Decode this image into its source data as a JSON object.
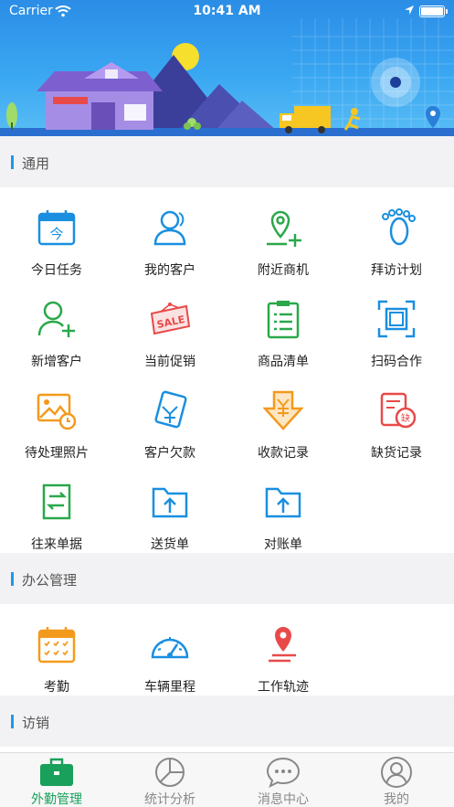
{
  "status_bar": {
    "carrier": "Carrier",
    "time": "10:41 AM"
  },
  "sections": [
    {
      "title": "通用",
      "items": [
        {
          "label": "今日任务",
          "icon": "calendar-today-icon",
          "color": "#1a8fe0"
        },
        {
          "label": "我的客户",
          "icon": "customers-icon",
          "color": "#1a8fe0"
        },
        {
          "label": "附近商机",
          "icon": "nearby-location-icon",
          "color": "#2aa84a"
        },
        {
          "label": "拜访计划",
          "icon": "footprint-icon",
          "color": "#1a8fe0"
        },
        {
          "label": "新增客户",
          "icon": "add-user-icon",
          "color": "#2aa84a"
        },
        {
          "label": "当前促销",
          "icon": "sale-tag-icon",
          "color": "#e84a4a"
        },
        {
          "label": "商品清单",
          "icon": "clipboard-list-icon",
          "color": "#2aa84a"
        },
        {
          "label": "扫码合作",
          "icon": "scan-icon",
          "color": "#1a8fe0"
        },
        {
          "label": "待处理照片",
          "icon": "photo-clock-icon",
          "color": "#f39a1d"
        },
        {
          "label": "客户欠款",
          "icon": "debt-icon",
          "color": "#1a8fe0"
        },
        {
          "label": "收款记录",
          "icon": "yen-download-icon",
          "color": "#f39a1d"
        },
        {
          "label": "缺货记录",
          "icon": "shortage-icon",
          "color": "#e84a4a"
        },
        {
          "label": "往来单据",
          "icon": "transfer-doc-icon",
          "color": "#2aa84a"
        },
        {
          "label": "送货单",
          "icon": "delivery-folder-icon",
          "color": "#1a8fe0"
        },
        {
          "label": "对账单",
          "icon": "statement-folder-icon",
          "color": "#1a8fe0"
        }
      ]
    },
    {
      "title": "办公管理",
      "items": [
        {
          "label": "考勤",
          "icon": "attendance-calendar-icon",
          "color": "#f39a1d"
        },
        {
          "label": "车辆里程",
          "icon": "speedometer-icon",
          "color": "#1a8fe0"
        },
        {
          "label": "工作轨迹",
          "icon": "track-pin-icon",
          "color": "#e84a4a"
        }
      ]
    },
    {
      "title": "访销",
      "items": []
    }
  ],
  "tabbar": [
    {
      "label": "外勤管理",
      "icon": "briefcase-icon",
      "active": true
    },
    {
      "label": "统计分析",
      "icon": "pie-chart-icon",
      "active": false
    },
    {
      "label": "消息中心",
      "icon": "chat-bubble-icon",
      "active": false
    },
    {
      "label": "我的",
      "icon": "profile-icon",
      "active": false
    }
  ]
}
